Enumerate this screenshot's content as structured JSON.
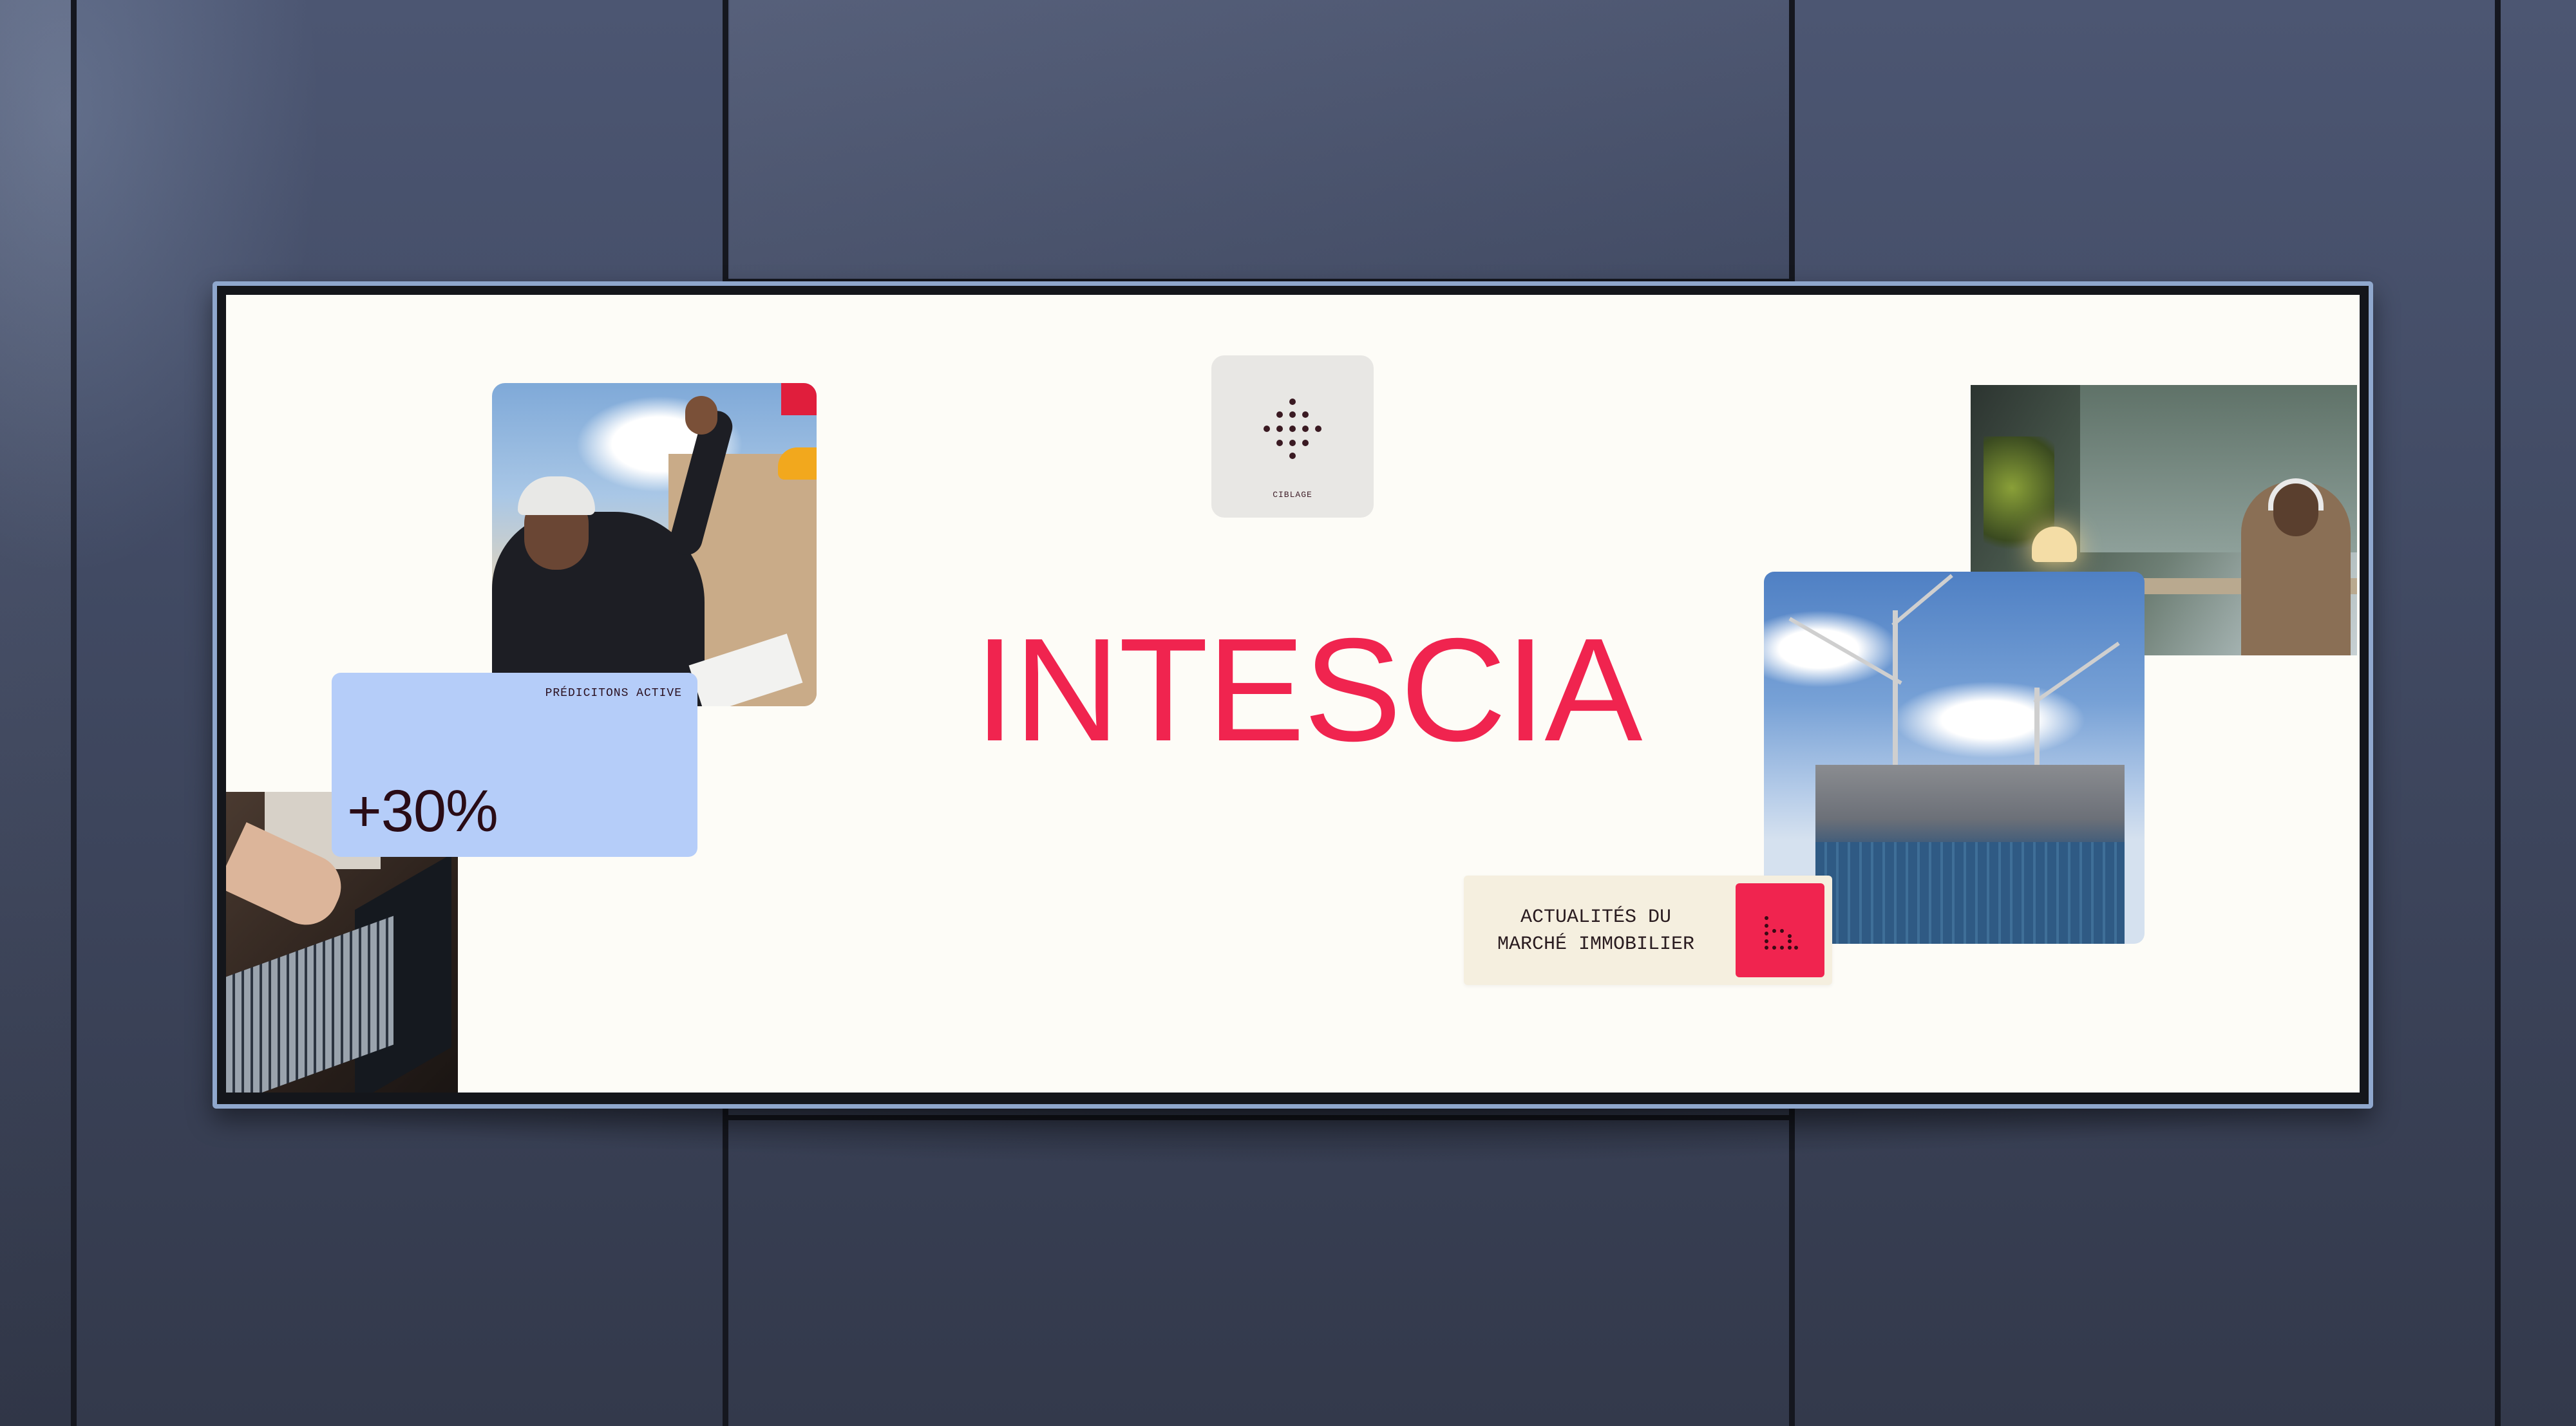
{
  "scene": {
    "description_hidden": false
  },
  "screen": {
    "brand": "INTESCIA",
    "ciblage_label": "CIBLAGE",
    "stat_label": "PRÉDICITONS ACTIVE",
    "stat_value": "+30%",
    "news_line1": "ACTUALITÉS DU",
    "news_line2": "MARCHÉ IMMOBILIER"
  },
  "colors": {
    "brand": "#f0244f",
    "stat_card": "#b5cdf9",
    "screen_bg": "#fdfcf7",
    "news_card": "#f5efdf"
  },
  "icons": {
    "ciblage": "dot-grid-icon",
    "news": "dotted-corner-icon"
  }
}
